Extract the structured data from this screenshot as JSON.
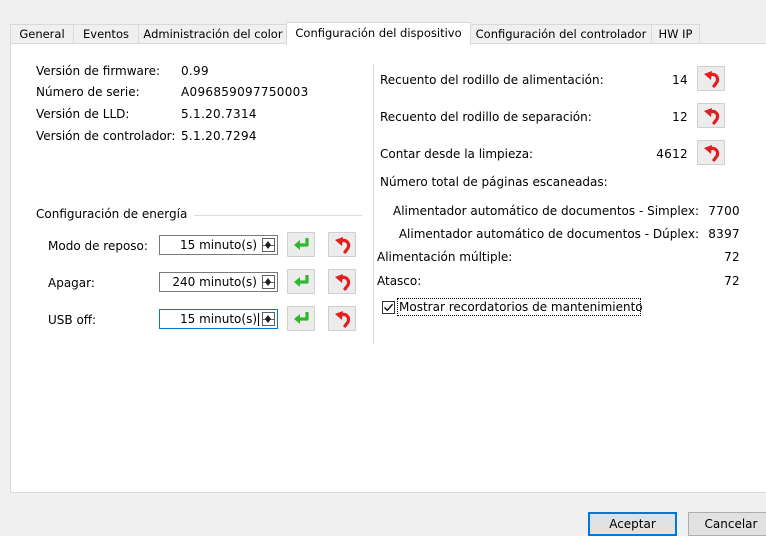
{
  "tabs": [
    {
      "label": "General"
    },
    {
      "label": "Eventos"
    },
    {
      "label": "Administración del color"
    },
    {
      "label": "Configuración del dispositivo"
    },
    {
      "label": "Configuración del controlador"
    },
    {
      "label": "HW IP"
    }
  ],
  "info": {
    "firmware_label": "Versión de firmware:",
    "firmware_value": "0.99",
    "serial_label": "Número de serie:",
    "serial_value": "A096859097750003",
    "lld_label": "Versión de LLD:",
    "lld_value": "5.1.20.7314",
    "driver_label": "Versión de controlador:",
    "driver_value": "5.1.20.7294"
  },
  "power": {
    "group_label": "Configuración de energía",
    "rows": [
      {
        "label": "Modo de reposo:",
        "value": "15 minuto(s)"
      },
      {
        "label": "Apagar:",
        "value": "240 minuto(s)"
      },
      {
        "label": "USB off:",
        "value": "15 minuto(s)"
      }
    ]
  },
  "counters": {
    "feed_label": "Recuento del rodillo de alimentación:",
    "feed_value": "14",
    "separation_label": "Recuento del rodillo de separación:",
    "separation_value": "12",
    "cleaning_label": "Contar desde la limpieza:",
    "cleaning_value": "4612",
    "total_label": "Número total de páginas escaneadas:",
    "simplex_label": "Alimentador automático de documentos - Simplex:",
    "simplex_value": "7700",
    "duplex_label": "Alimentador automático de documentos - Dúplex:",
    "duplex_value": "8397",
    "multifeed_label": "Alimentación múltiple:",
    "multifeed_value": "72",
    "jam_label": "Atasco:",
    "jam_value": "72"
  },
  "maintenance_checkbox": {
    "label": "Mostrar recordatorios de mantenimiento",
    "checked": true
  },
  "footer": {
    "ok_label": "Aceptar",
    "cancel_label": "Cancelar"
  },
  "colors": {
    "apply_green": "#2eb82e",
    "reset_red": "#e02020",
    "focus_blue": "#0078d7"
  },
  "icons": {
    "apply": "green-enter-arrow-icon",
    "reset": "red-undo-arrow-icon"
  }
}
